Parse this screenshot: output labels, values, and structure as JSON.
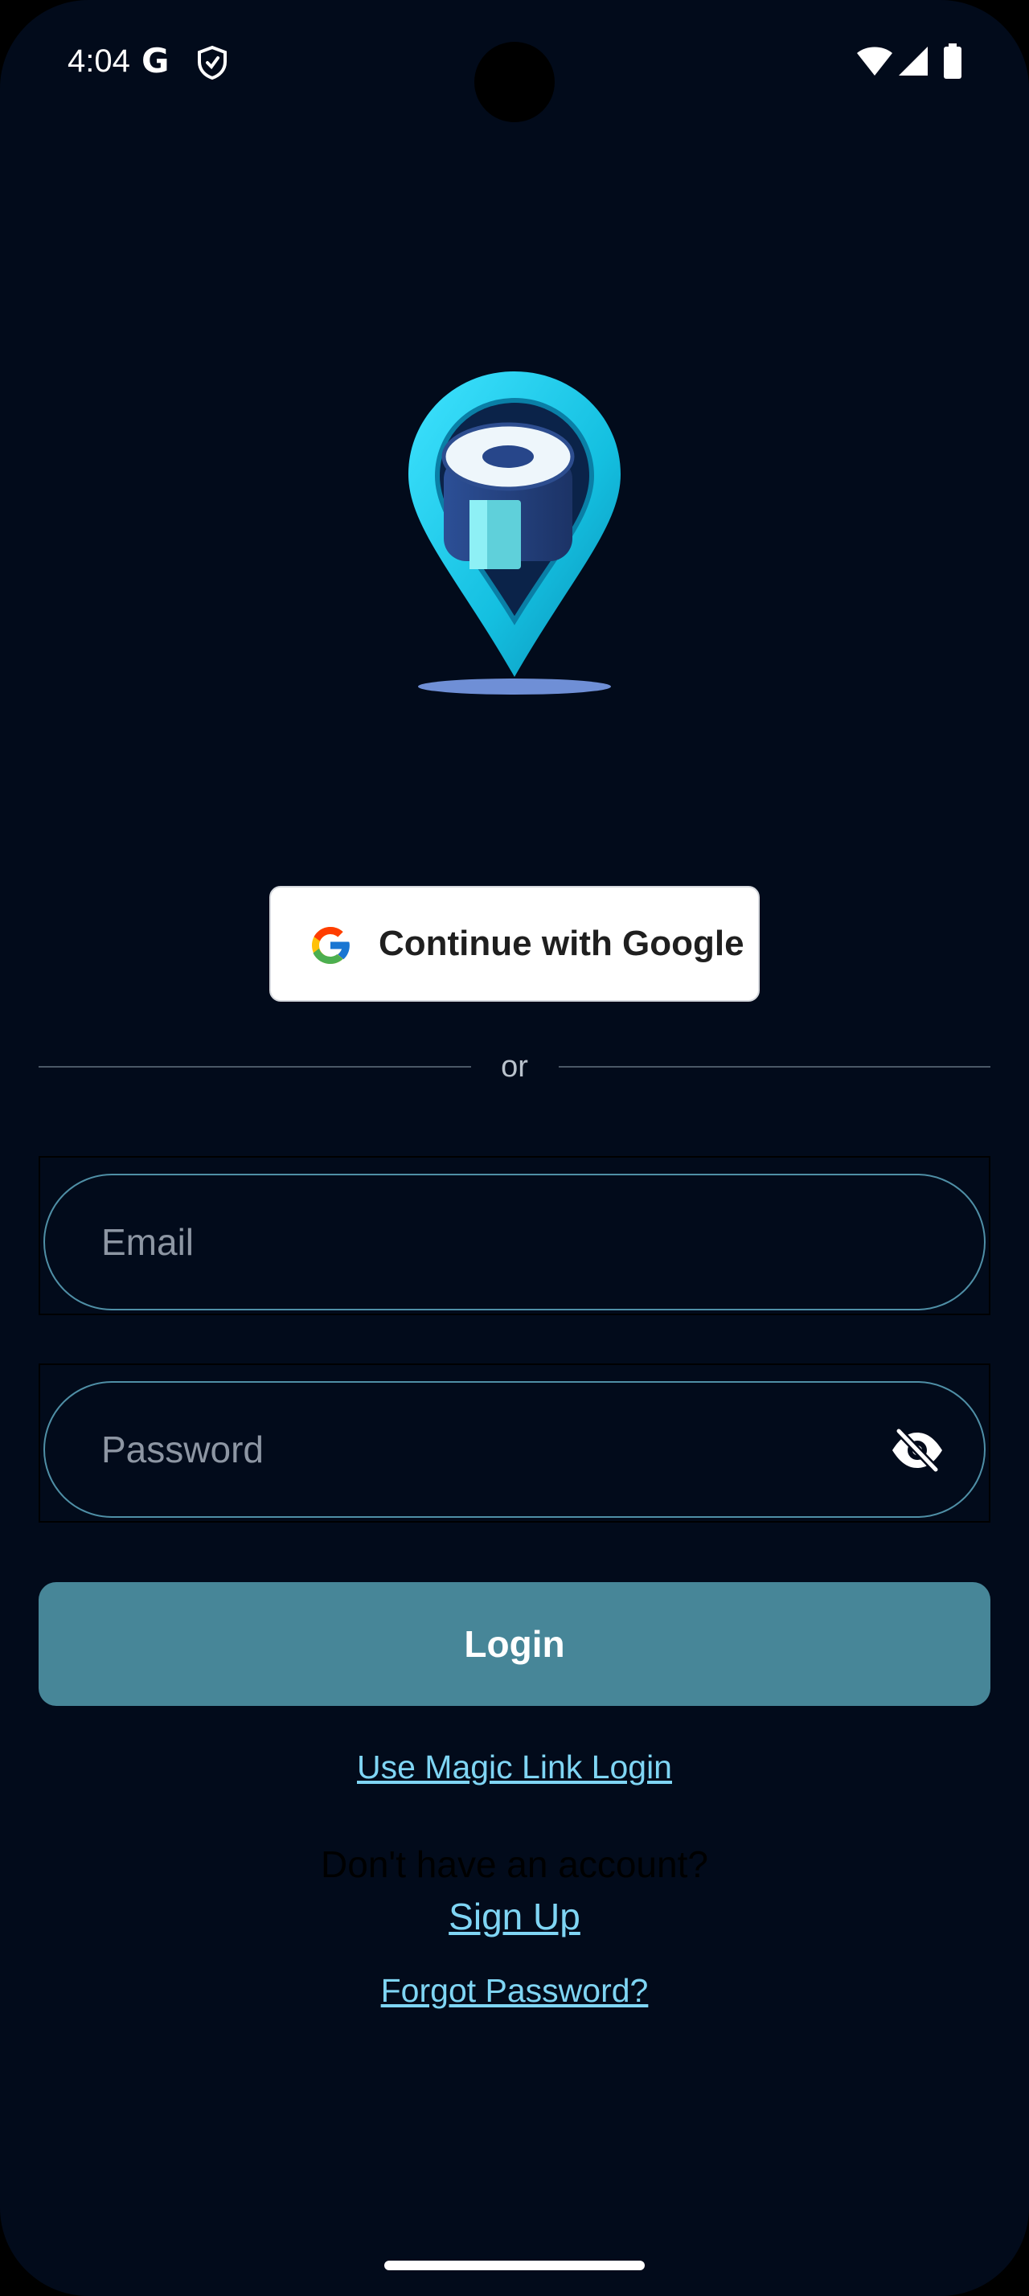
{
  "status_bar": {
    "time": "4:04",
    "notification_icon_letter": "G",
    "icons": [
      "google-icon",
      "shield-icon",
      "wifi-icon",
      "signal-icon",
      "battery-icon"
    ]
  },
  "logo": {
    "icon": "map-pin-roll-logo",
    "colors": {
      "pin": "#1cc8e8",
      "roll": "#2a4a8f"
    }
  },
  "google_button": {
    "label": "Continue with Google",
    "icon": "google-g-icon"
  },
  "divider": {
    "label": "or"
  },
  "email_field": {
    "placeholder": "Email",
    "value": ""
  },
  "password_field": {
    "placeholder": "Password",
    "value": "",
    "toggle_icon": "eye-off-icon"
  },
  "login_button": {
    "label": "Login"
  },
  "links": {
    "magic_link": "Use Magic Link Login",
    "no_account": "Don't have an account?",
    "sign_up": "Sign Up",
    "forgot_password": "Forgot Password?"
  },
  "colors": {
    "background": "#020b1b",
    "accent": "#478698",
    "link": "#7fd5f4",
    "field_border": "#4f8fa6"
  }
}
